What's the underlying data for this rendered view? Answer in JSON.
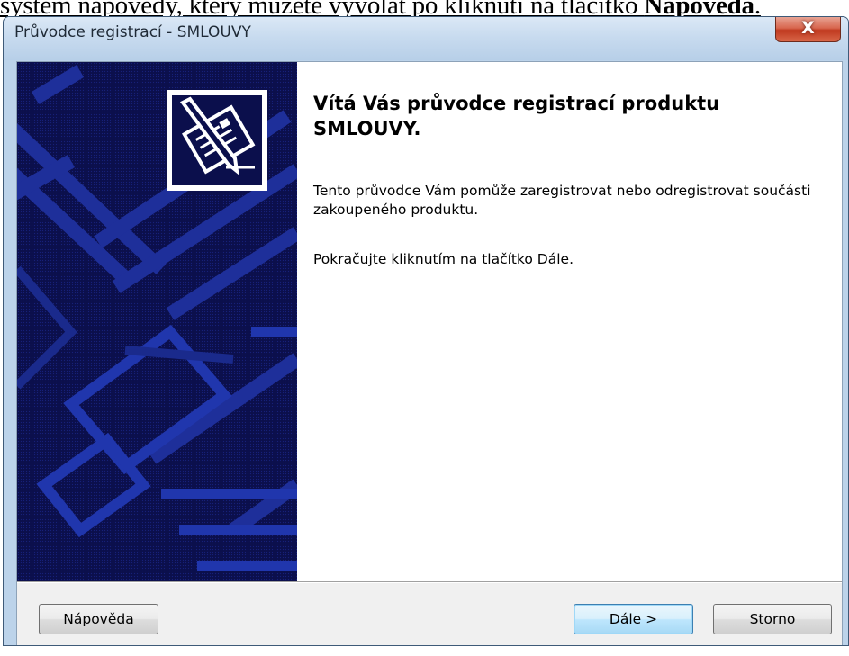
{
  "document": {
    "text_before": "systém nápovědy, který můžete vyvolat po kliknutí na tlačítko ",
    "text_bold": "Nápověda",
    "text_after": "."
  },
  "window": {
    "title": "Průvodce registrací - SMLOUVY",
    "close_glyph": "X"
  },
  "wizard": {
    "heading": "Vítá Vás průvodce registrací produktu SMLOUVY.",
    "paragraph1": "Tento průvodce Vám pomůže zaregistrovat nebo odregistrovat součásti zakoupeného produktu.",
    "paragraph2": "Pokračujte kliknutím na tlačítko Dále."
  },
  "buttons": {
    "help": "Nápověda",
    "next_accel": "D",
    "next_rest": "ále >",
    "cancel": "Storno"
  },
  "colors": {
    "banner": "#0b0f4c",
    "banner_lines": "#1e2f9a"
  }
}
